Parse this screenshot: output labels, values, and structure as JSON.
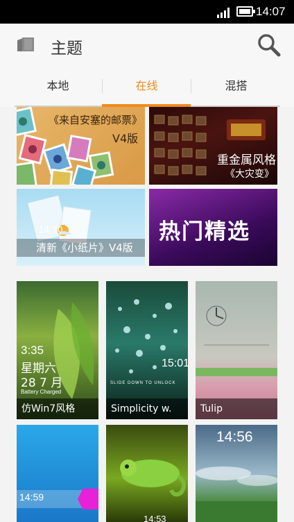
{
  "status_bar": {
    "time": "14:07"
  },
  "header": {
    "title": "主题"
  },
  "tabs": [
    {
      "label": "本地",
      "active": false
    },
    {
      "label": "在线",
      "active": true
    },
    {
      "label": "混搭",
      "active": false
    }
  ],
  "banners": [
    {
      "line1": "《来自安塞的邮票》",
      "line2": "V4版"
    },
    {
      "line1": "重金属风格",
      "line2": "《大灾变》"
    },
    {
      "line1": "清新《小纸片》V4版",
      "clock": "14:50"
    },
    {
      "line1": "热门精选"
    }
  ],
  "themes": [
    {
      "caption": "仿Win7风格",
      "time": "3:35",
      "weekday": "星期六",
      "date": "28 7 月",
      "status": "Battery Charged"
    },
    {
      "caption": "Simplicity w.",
      "time": "15:01",
      "unlock": "SLIDE DOWN TO UNLOCK"
    },
    {
      "caption": "Tulip"
    },
    {
      "caption": "",
      "time": "14:59"
    },
    {
      "caption": "",
      "time": "14:53"
    },
    {
      "caption": "",
      "time": "14:56"
    }
  ],
  "colors": {
    "accent": "#f08a1c"
  }
}
